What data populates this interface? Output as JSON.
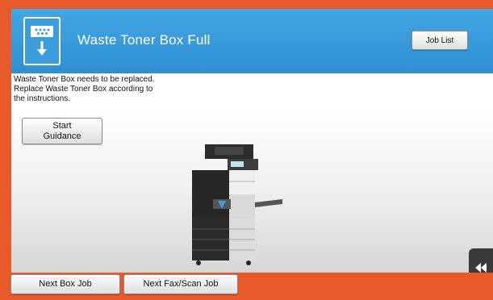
{
  "header": {
    "title": "Waste Toner Box Full",
    "job_list_label": "Job List"
  },
  "message": {
    "lines": [
      "Waste Toner Box needs to be replaced.",
      "Replace Waste Toner Box according to",
      "the instructions."
    ]
  },
  "guidance": {
    "start_label_line1": "Start",
    "start_label_line2": "Guidance"
  },
  "footer": {
    "next_box_job_label": "Next Box Job",
    "next_fax_scan_job_label": "Next Fax/Scan Job"
  },
  "colors": {
    "frame": "#e85a2a",
    "header": "#3a9ad9"
  },
  "icons": {
    "header_icon": "waste-toner-icon",
    "nav_icon": "double-chevron-left-icon"
  }
}
